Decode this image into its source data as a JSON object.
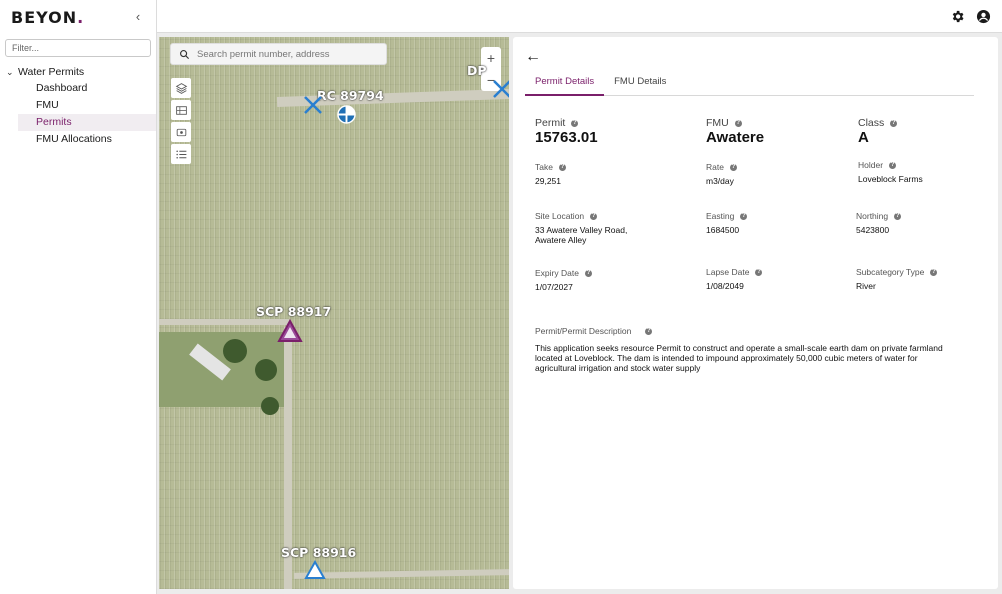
{
  "brand": {
    "name": "BEYON",
    "dot": "."
  },
  "sidebar": {
    "filter_placeholder": "Filter...",
    "group": "Water Permits",
    "items": [
      {
        "label": "Dashboard",
        "active": false
      },
      {
        "label": "FMU",
        "active": false
      },
      {
        "label": "Permits",
        "active": true
      },
      {
        "label": "FMU Allocations",
        "active": false
      }
    ]
  },
  "map": {
    "search_placeholder": "Search permit number, address",
    "zoom_in": "+",
    "zoom_out": "−",
    "markers": [
      {
        "label": "RC 89794"
      },
      {
        "label": "SCP 88917"
      },
      {
        "label": "SCP 88916"
      },
      {
        "label": "DP"
      }
    ]
  },
  "details": {
    "back": "←",
    "tabs": [
      "Permit Details",
      "FMU Details"
    ],
    "active_tab": "Permit Details",
    "permit": {
      "label": "Permit",
      "value": "15763.01"
    },
    "fmu": {
      "label": "FMU",
      "value": "Awatere"
    },
    "class": {
      "label": "Class",
      "value": "A"
    },
    "take": {
      "label": "Take",
      "value": "29,251"
    },
    "rate": {
      "label": "Rate",
      "value": "m3/day"
    },
    "holder": {
      "label": "Holder",
      "value": "Loveblock Farms"
    },
    "site_location": {
      "label": "Site Location",
      "value_line1": "33 Awatere Valley Road,",
      "value_line2": "Awatere Alley"
    },
    "easting": {
      "label": "Easting",
      "value": "1684500"
    },
    "northing": {
      "label": "Northing",
      "value": "5423800"
    },
    "expiry_date": {
      "label": "Expiry Date",
      "value": "1/07/2027"
    },
    "lapse_date": {
      "label": "Lapse Date",
      "value": "1/08/2049"
    },
    "subcategory_type": {
      "label": "Subcategory Type",
      "value": "River"
    },
    "description": {
      "label": "Permit/Permit Description",
      "value": "This application seeks resource Permit to construct and operate a small-scale earth dam on private farmland located at Loveblock. The dam is intended to impound approximately 50,000 cubic meters of water for agricultural irrigation and stock water supply"
    }
  },
  "colors": {
    "accent": "#7a1f6a",
    "marker_blue": "#1f6fb5"
  }
}
